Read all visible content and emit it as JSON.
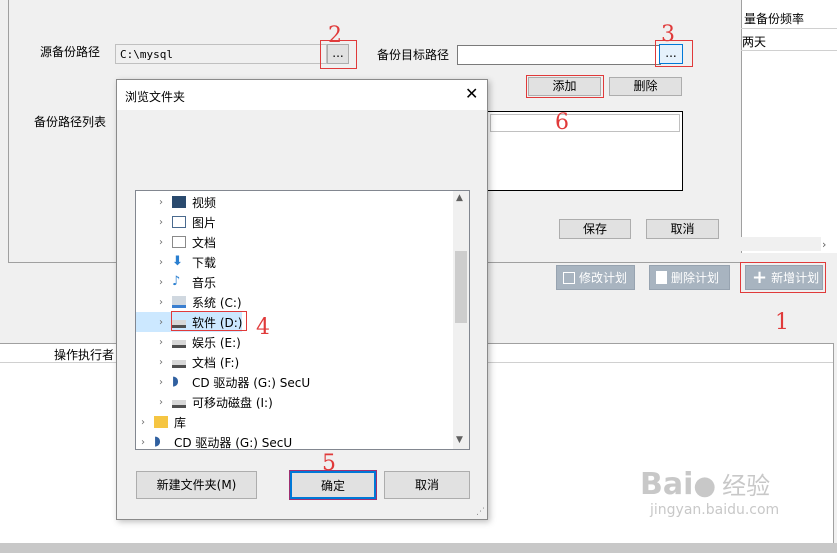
{
  "form": {
    "source_path_label": "源备份路径",
    "source_path_value": "C:\\mysql",
    "browse_label": "...",
    "target_path_label": "备份目标路径",
    "target_path_value": "",
    "add_label": "添加",
    "delete_label": "删除",
    "list_label": "备份路径列表",
    "save_label": "保存",
    "cancel_label": "取消"
  },
  "right_panel": {
    "col_header": "量备份频率",
    "row_value": "两天"
  },
  "plan_buttons": {
    "edit": "修改计划",
    "delete": "删除计划",
    "add": "新增计划"
  },
  "log_table": {
    "col_operator": "操作执行者"
  },
  "dialog": {
    "title": "浏览文件夹",
    "tree": [
      {
        "label": "视频",
        "icon": "video-folder-icon",
        "level": 1
      },
      {
        "label": "图片",
        "icon": "picture-folder-icon",
        "level": 1
      },
      {
        "label": "文档",
        "icon": "document-folder-icon",
        "level": 1
      },
      {
        "label": "下载",
        "icon": "download-folder-icon",
        "level": 1
      },
      {
        "label": "音乐",
        "icon": "music-folder-icon",
        "level": 1
      },
      {
        "label": "系统 (C:)",
        "icon": "system-drive-icon",
        "level": 1
      },
      {
        "label": "软件 (D:)",
        "icon": "drive-icon",
        "level": 1
      },
      {
        "label": "娱乐 (E:)",
        "icon": "drive-icon",
        "level": 1
      },
      {
        "label": "文档 (F:)",
        "icon": "drive-icon",
        "level": 1
      },
      {
        "label": "CD 驱动器 (G:) SecU",
        "icon": "cd-drive-icon",
        "level": 1
      },
      {
        "label": "可移动磁盘 (I:)",
        "icon": "removable-drive-icon",
        "level": 1
      },
      {
        "label": "库",
        "icon": "library-icon",
        "level": 0
      },
      {
        "label": "CD 驱动器 (G:) SecU",
        "icon": "cd-drive-icon",
        "level": 0
      }
    ],
    "new_folder_label": "新建文件夹(M)",
    "ok_label": "确定",
    "cancel_label": "取消"
  },
  "annotations": [
    "1",
    "2",
    "3",
    "4",
    "5",
    "6"
  ],
  "watermark": {
    "brand": "Bai",
    "brand2": "经验",
    "url": "jingyan.baidu.com"
  },
  "colors": {
    "annotation": "#e03a3a",
    "plan_button": "#a8b4c0",
    "selection": "#cce8ff"
  }
}
